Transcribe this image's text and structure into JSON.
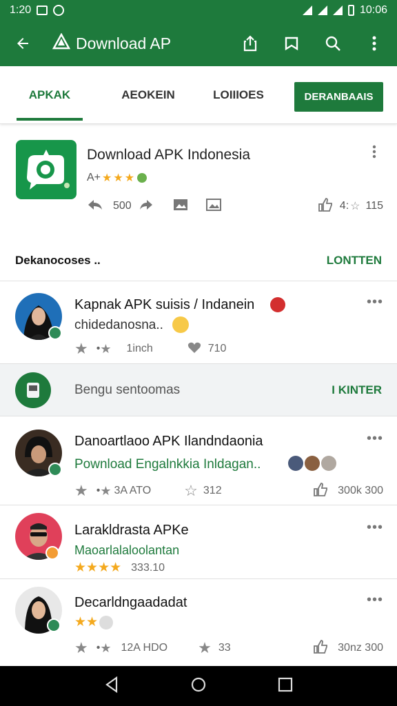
{
  "status_bar": {
    "time": "1:20",
    "right_time": "10:06"
  },
  "app_bar": {
    "title": "Download AP"
  },
  "tabs": [
    {
      "label": "APKAK"
    },
    {
      "label": "AEOKEIN"
    },
    {
      "label": "LOIIIOES"
    }
  ],
  "tab_button": "DERANBAAIS",
  "hero": {
    "name": "Download APK Indonesia",
    "rating_prefix": "A+",
    "stat_left": "500",
    "stat_right_a": "4:",
    "stat_right_b": "115"
  },
  "section": {
    "title": "Dekanocoses ..",
    "action": "LONTTEN"
  },
  "items": [
    {
      "title": "Kapnak APK suisis / Indanein",
      "subtitle": "chidedanosna..",
      "meta_left": "1inch",
      "meta_right": "710"
    },
    {
      "title": "Danoartlaoo APK Ilandndaonia",
      "subtitle": "Pownload Engalnkkia Inldagan..",
      "meta_left": "3A ATO",
      "meta_mid": "312",
      "meta_right": "300k 300"
    },
    {
      "title": "Larakldrasta APKe",
      "subtitle": "Maoarlalaloolantan",
      "meta_left": "333.10"
    },
    {
      "title": "Decarldngaadadat",
      "meta_left": "12A HDO",
      "meta_mid": "33",
      "meta_right": "30nz 300"
    }
  ],
  "promo": {
    "text": "Bengu sentoomas",
    "action": "I KINTER"
  },
  "colors": {
    "primary": "#1e7a3c",
    "accent_star": "#f4a91d"
  },
  "icons": [
    "back-arrow-icon",
    "app-logo-icon",
    "share-icon",
    "bookmark-icon",
    "search-icon",
    "more-vert-icon",
    "thumbs-up-icon",
    "heart-icon",
    "star-icon",
    "nav-back-icon",
    "nav-home-icon",
    "nav-recents-icon"
  ]
}
